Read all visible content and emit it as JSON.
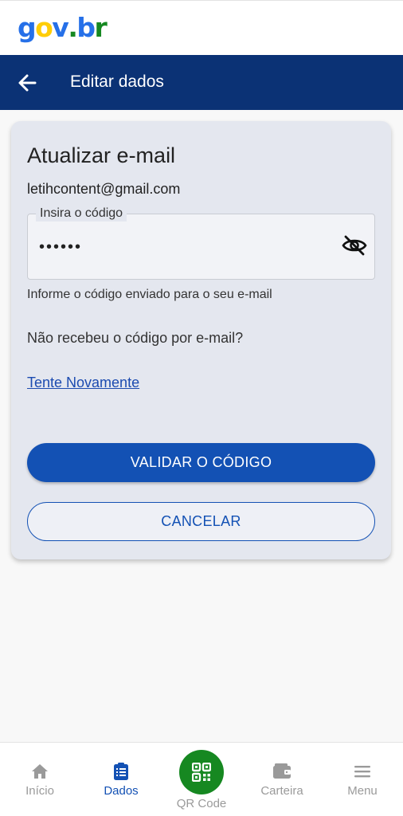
{
  "brand": {
    "logo_letters": [
      "g",
      "o",
      "v",
      ".",
      "b",
      "r"
    ],
    "logo_colors": [
      "#2670e8",
      "#ffcd07",
      "#2670e8",
      "#168821",
      "#2670e8",
      "#168821"
    ]
  },
  "header": {
    "title": "Editar dados",
    "back_icon": "arrow-left-icon"
  },
  "card": {
    "title": "Atualizar e-mail",
    "email": "letihcontent@gmail.com",
    "code_field": {
      "label": "Insira o código",
      "value": "••••••",
      "toggle_icon": "eye-off-icon"
    },
    "helper_text": "Informe o código enviado para o seu e-mail",
    "question": "Não recebeu o código por e-mail?",
    "retry_link": "Tente Novamente",
    "validate_button": "VALIDAR O CÓDIGO",
    "cancel_button": "CANCELAR"
  },
  "bottom_nav": {
    "items": [
      {
        "label": "Início",
        "icon": "home-icon",
        "active": false
      },
      {
        "label": "Dados",
        "icon": "clipboard-list-icon",
        "active": true
      },
      {
        "label": "QR Code",
        "icon": "qr-code-icon",
        "active": false
      },
      {
        "label": "Carteira",
        "icon": "wallet-icon",
        "active": false
      },
      {
        "label": "Menu",
        "icon": "menu-icon",
        "active": false
      }
    ]
  },
  "colors": {
    "primary_blue": "#1351b4",
    "header_blue": "#0b3275",
    "qr_green": "#168821",
    "inactive_gray": "#9a9a9a"
  }
}
